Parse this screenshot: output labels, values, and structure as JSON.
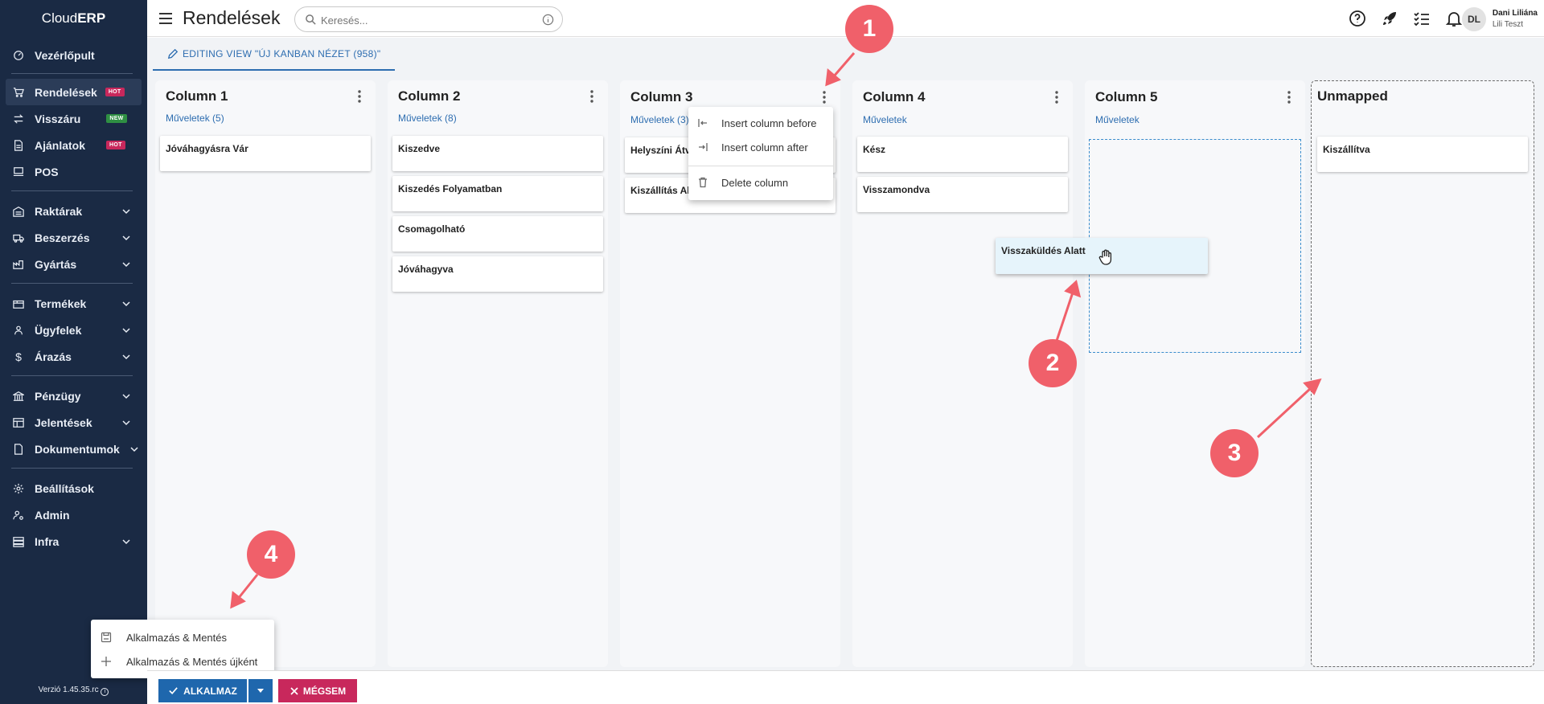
{
  "brand": {
    "prefix": "Cloud",
    "suffix": "ERP"
  },
  "sidebar": {
    "items": [
      {
        "label": "Vezérlőpult",
        "icon": "dashboard-icon"
      },
      {
        "label": "Rendelések",
        "icon": "cart-icon",
        "badge": "HOT",
        "active": true
      },
      {
        "label": "Visszáru",
        "icon": "swap-icon",
        "badge": "NEW"
      },
      {
        "label": "Ajánlatok",
        "icon": "document-icon",
        "badge": "HOT"
      },
      {
        "label": "POS",
        "icon": "pos-icon"
      },
      {
        "label": "Raktárak",
        "icon": "warehouse-icon"
      },
      {
        "label": "Beszerzés",
        "icon": "truck-icon"
      },
      {
        "label": "Gyártás",
        "icon": "factory-icon"
      },
      {
        "label": "Termékek",
        "icon": "box-icon"
      },
      {
        "label": "Ügyfelek",
        "icon": "people-icon"
      },
      {
        "label": "Árazás",
        "icon": "dollar-icon"
      },
      {
        "label": "Pénzügy",
        "icon": "bank-icon"
      },
      {
        "label": "Jelentések",
        "icon": "table-icon"
      },
      {
        "label": "Dokumentumok",
        "icon": "file-icon"
      },
      {
        "label": "Beállítások",
        "icon": "gear-icon"
      },
      {
        "label": "Admin",
        "icon": "user-gear-icon"
      },
      {
        "label": "Infra",
        "icon": "server-icon"
      }
    ],
    "version": "Verzió 1.45.35.rc"
  },
  "header": {
    "title": "Rendelések",
    "search_placeholder": "Keresés...",
    "user_name": "Dani Liliána",
    "user_role": "Lili Teszt",
    "avatar_initials": "DL"
  },
  "tab": {
    "label": "EDITING VIEW \"ÚJ KANBAN NÉZET (958)\""
  },
  "columns": [
    {
      "title": "Column 1",
      "link": "Műveletek (5)",
      "cards": [
        "Jóváhagyásra Vár"
      ]
    },
    {
      "title": "Column 2",
      "link": "Műveletek (8)",
      "cards": [
        "Kiszedve",
        "Kiszedés Folyamatban",
        "Csomagolható",
        "Jóváhagyva"
      ]
    },
    {
      "title": "Column 3",
      "link": "Műveletek (3)",
      "cards": [
        "Helyszíni Átvé",
        "Kiszállítás Ala"
      ]
    },
    {
      "title": "Column 4",
      "link": "Műveletek",
      "cards": [
        "Kész",
        "Visszamondva"
      ]
    },
    {
      "title": "Column 5",
      "link": "Műveletek",
      "cards": []
    },
    {
      "title": "Unmapped",
      "link": "",
      "cards": [
        "Kiszállítva"
      ]
    }
  ],
  "dragging_card": "Visszaküldés Alatt",
  "context_menu": {
    "insert_before": "Insert column before",
    "insert_after": "Insert column after",
    "delete": "Delete column"
  },
  "save_menu": {
    "save": "Alkalmazás & Mentés",
    "save_new": "Alkalmazás & Mentés újként"
  },
  "footer": {
    "apply": "ALKALMAZ",
    "cancel": "MÉGSEM"
  },
  "callouts": [
    "1",
    "2",
    "3",
    "4"
  ],
  "colors": {
    "sidebar": "#1a2a44",
    "accent": "#1f67ad",
    "danger": "#c8285c",
    "callout": "#f0606a"
  }
}
